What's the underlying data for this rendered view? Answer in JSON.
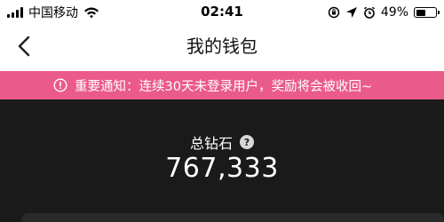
{
  "status_bar": {
    "carrier": "中国移动",
    "time": "02:41",
    "battery_percent": "49%",
    "battery_level": 0.49,
    "icons": [
      "signal-icon",
      "wifi-icon",
      "rotation-lock-icon",
      "location-icon",
      "alarm-icon",
      "battery-icon"
    ]
  },
  "nav": {
    "title": "我的钱包",
    "back_icon": "chevron-left-icon"
  },
  "banner": {
    "text": "重要通知：连续30天未登录用户，奖励将会被收回~",
    "icon": "info-icon"
  },
  "wallet": {
    "label": "总钻石",
    "help_symbol": "?",
    "value": "767,333"
  },
  "colors": {
    "banner_bg": "#ea5a8b",
    "content_bg": "#1a1a1a",
    "header_bg": "#ffffff"
  }
}
